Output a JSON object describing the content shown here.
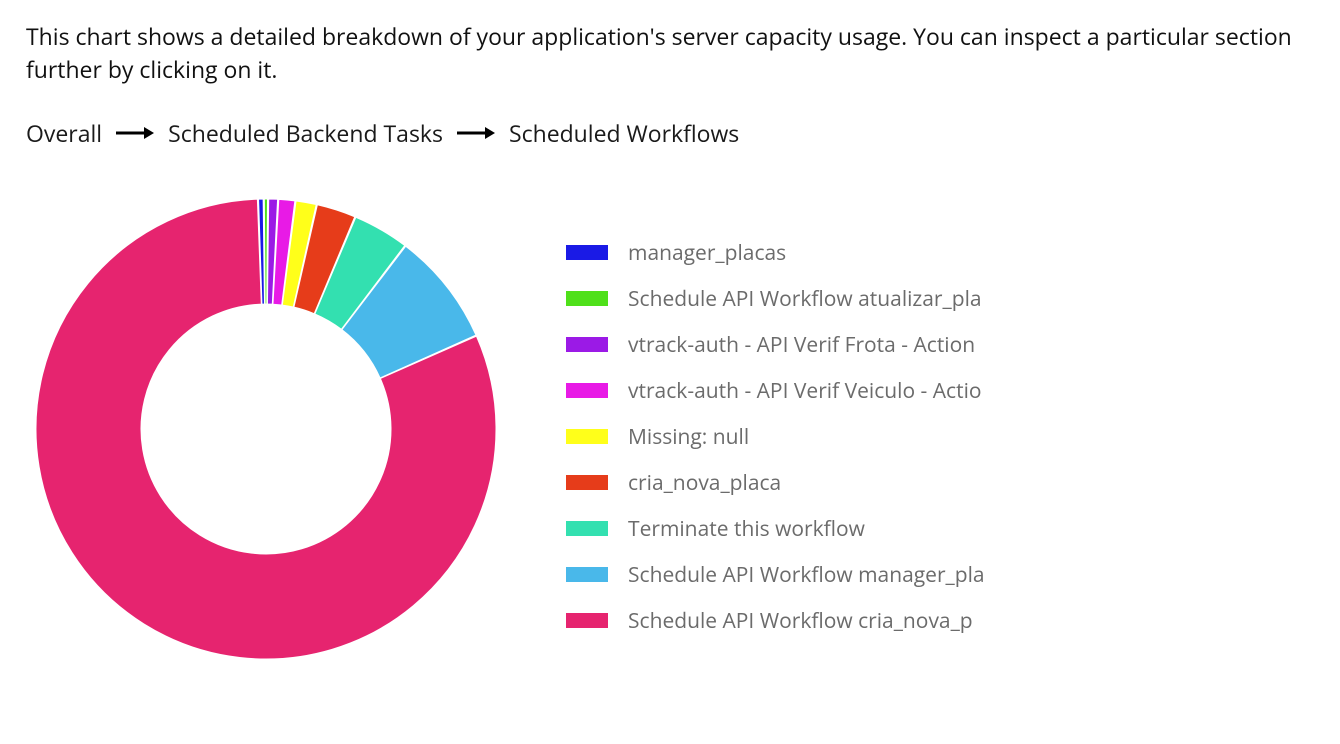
{
  "description": "This chart shows a detailed breakdown of your application's server capacity usage. You can inspect a particular section further by clicking on it.",
  "breadcrumb": {
    "items": [
      {
        "label": "Overall"
      },
      {
        "label": "Scheduled Backend Tasks"
      },
      {
        "label": "Scheduled Workflows"
      }
    ]
  },
  "chart_data": {
    "type": "pie",
    "title": "",
    "series": [
      {
        "name": "manager_placas",
        "value": 0.4,
        "color": "#1a1ae6"
      },
      {
        "name": "Schedule API Workflow atualizar_pla",
        "value": 0.3,
        "color": "#4fe01a"
      },
      {
        "name": "vtrack-auth - API Verif Frota - Action",
        "value": 0.7,
        "color": "#9b1ae6"
      },
      {
        "name": "vtrack-auth - API Verif Veiculo - Actio",
        "value": 1.2,
        "color": "#e81ae6"
      },
      {
        "name": "Missing: null",
        "value": 1.5,
        "color": "#ffff1a"
      },
      {
        "name": "cria_nova_placa",
        "value": 2.8,
        "color": "#e63c1a"
      },
      {
        "name": "Terminate this workflow",
        "value": 4.0,
        "color": "#33e0b0"
      },
      {
        "name": "Schedule API Workflow manager_pla",
        "value": 8.0,
        "color": "#49b8ea"
      },
      {
        "name": "Schedule API Workflow cria_nova_p",
        "value": 81.1,
        "color": "#e6246f"
      }
    ]
  }
}
